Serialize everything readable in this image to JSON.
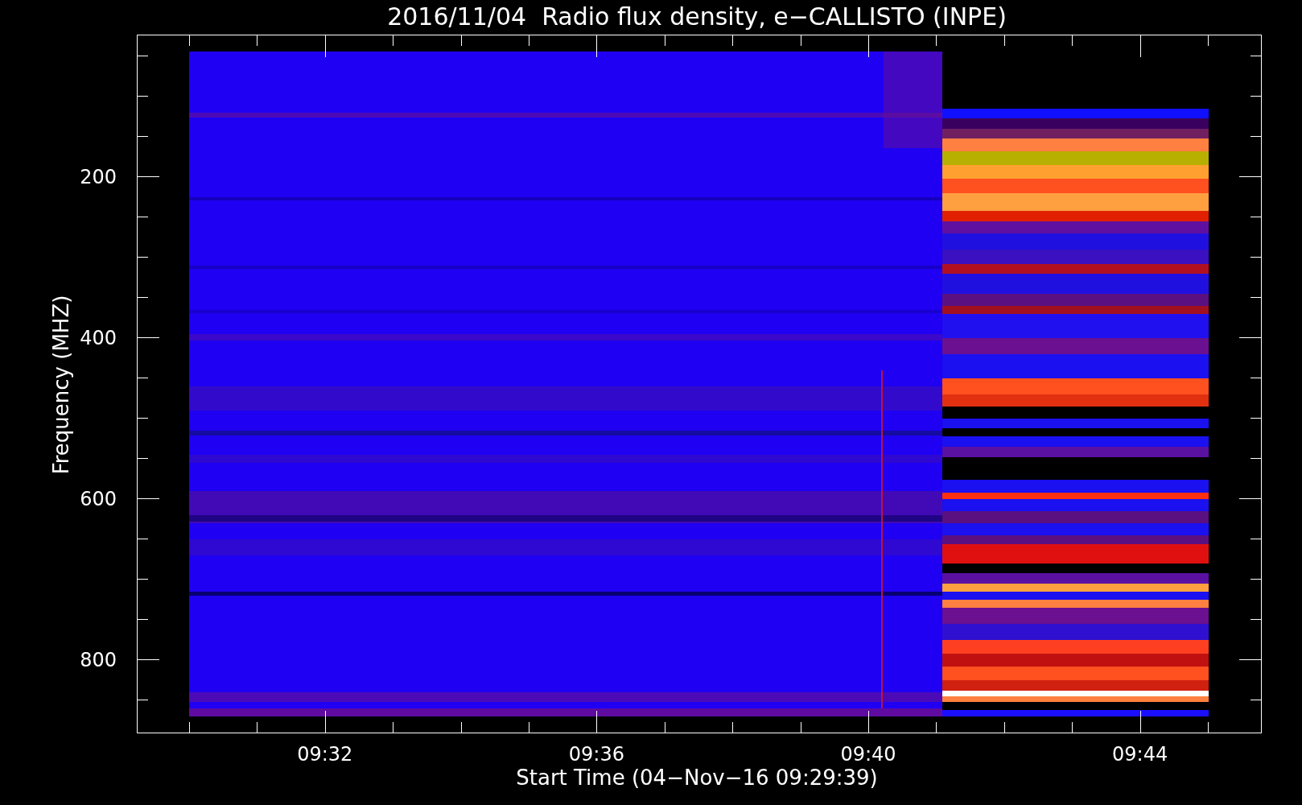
{
  "plot": {
    "title": "2016/11/04  Radio flux density, e−CALLISTO (INPE)",
    "ylabel": "Frequency (MHZ)",
    "xlabel": "Start Time (04−Nov−16 09:29:39)",
    "yticks": [
      "200",
      "400",
      "600",
      "800"
    ],
    "xticks": [
      "09:32",
      "09:36",
      "09:40",
      "09:44"
    ]
  }
}
